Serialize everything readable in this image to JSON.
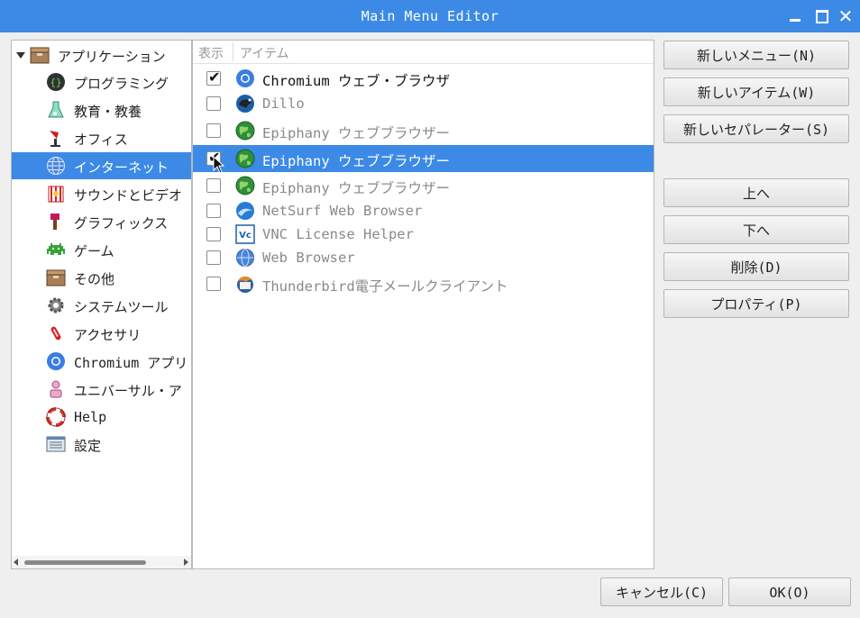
{
  "window": {
    "title": "Main Menu Editor"
  },
  "tree": {
    "root_label": "アプリケーション",
    "items": [
      {
        "label": "プログラミング",
        "icon": "programming-icon"
      },
      {
        "label": "教育・教養",
        "icon": "education-icon"
      },
      {
        "label": "オフィス",
        "icon": "office-icon"
      },
      {
        "label": "インターネット",
        "icon": "internet-icon",
        "selected": true
      },
      {
        "label": "サウンドとビデオ",
        "icon": "sound-video-icon"
      },
      {
        "label": "グラフィックス",
        "icon": "graphics-icon"
      },
      {
        "label": "ゲーム",
        "icon": "games-icon"
      },
      {
        "label": "その他",
        "icon": "other-icon"
      },
      {
        "label": "システムツール",
        "icon": "system-tools-icon"
      },
      {
        "label": "アクセサリ",
        "icon": "accessories-icon"
      },
      {
        "label": "Chromium アプリ",
        "icon": "chromium-apps-icon"
      },
      {
        "label": "ユニバーサル・ア",
        "icon": "universal-access-icon"
      },
      {
        "label": "Help",
        "icon": "help-icon"
      },
      {
        "label": "設定",
        "icon": "settings-icon"
      }
    ]
  },
  "items_list": {
    "col_show": "表示",
    "col_item": "アイテム",
    "rows": [
      {
        "name": "Chromium ウェブ・ブラウザ",
        "checked": true,
        "icon": "chromium-icon"
      },
      {
        "name": "Dillo",
        "checked": false,
        "icon": "dillo-icon"
      },
      {
        "name": "Epiphany ウェブブラウザー",
        "checked": false,
        "icon": "epiphany-icon"
      },
      {
        "name": "Epiphany ウェブブラウザー",
        "checked": true,
        "icon": "epiphany-icon",
        "selected": true
      },
      {
        "name": "Epiphany ウェブブラウザー",
        "checked": false,
        "icon": "epiphany-icon"
      },
      {
        "name": "NetSurf Web Browser",
        "checked": false,
        "icon": "netsurf-icon"
      },
      {
        "name": "VNC License Helper",
        "checked": false,
        "icon": "vnc-icon"
      },
      {
        "name": "Web Browser",
        "checked": false,
        "icon": "web-browser-icon"
      },
      {
        "name": "Thunderbird電子メールクライアント",
        "checked": false,
        "icon": "thunderbird-icon"
      }
    ]
  },
  "buttons": {
    "new_menu": "新しいメニュー(N)",
    "new_item": "新しいアイテム(W)",
    "new_separator": "新しいセパレーター(S)",
    "move_up": "上へ",
    "move_down": "下へ",
    "delete": "削除(D)",
    "properties": "プロパティ(P)",
    "cancel": "キャンセル(C)",
    "ok": "OK(O)"
  },
  "colors": {
    "selection": "#3c8ae6",
    "titlebar": "#3c8ae6"
  }
}
